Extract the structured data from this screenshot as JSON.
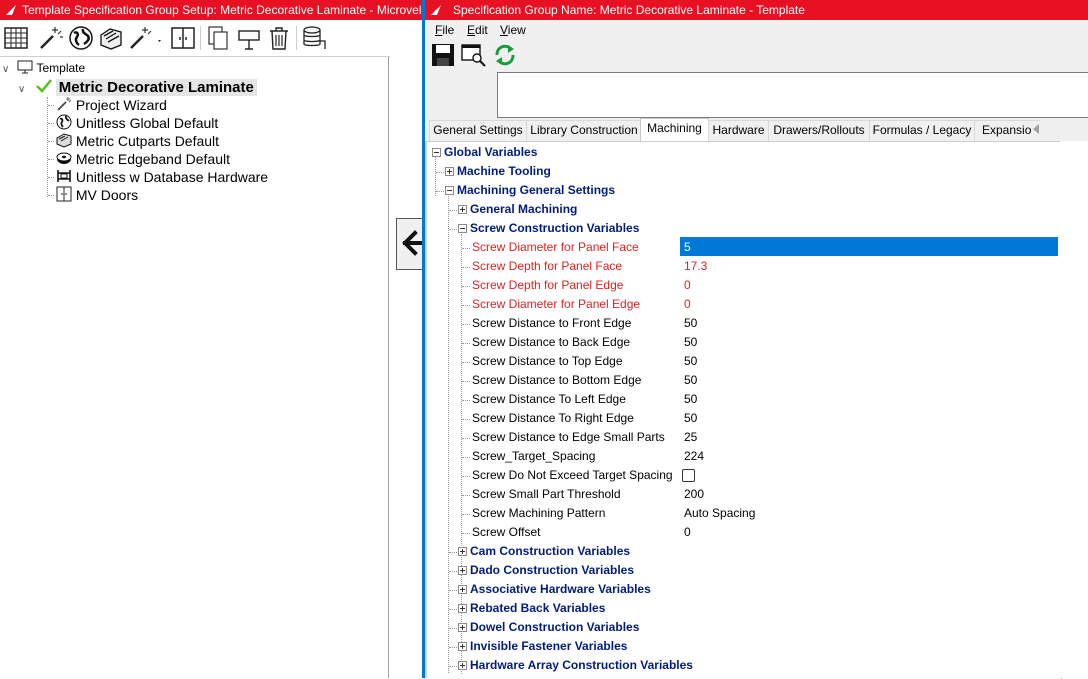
{
  "left_window": {
    "title": "Template Specification Group Setup: Metric Decorative Laminate - Microvellum",
    "toolbar_icons": [
      "grid-icon",
      "wand-icon",
      "globe-icon",
      "cutparts-icon",
      "wand-dropdown-icon",
      "doors-icon",
      "copy-icon",
      "move-icon",
      "trash-icon",
      "database-icon"
    ],
    "tree": {
      "root": "Template",
      "selected": "Metric Decorative Laminate",
      "children": [
        {
          "label": "Project Wizard",
          "icon": "wand-icon"
        },
        {
          "label": "Unitless Global Default",
          "icon": "globe-icon"
        },
        {
          "label": "Metric Cutparts Default",
          "icon": "cutparts-icon"
        },
        {
          "label": "Metric Edgeband Default",
          "icon": "edgeband-icon"
        },
        {
          "label": "Unitless w Database Hardware",
          "icon": "hardware-icon"
        },
        {
          "label": "MV Doors",
          "icon": "doors-icon"
        }
      ]
    }
  },
  "right_window": {
    "title": "Specification Group Name: Metric Decorative Laminate - Template",
    "menu": [
      "File",
      "Edit",
      "View"
    ],
    "toolbar_icons": [
      "save-icon",
      "preview-icon",
      "refresh-icon"
    ],
    "tabs": [
      "General Settings",
      "Library Construction",
      "Machining",
      "Hardware",
      "Drawers/Rollouts",
      "Formulas / Legacy",
      "Expansion"
    ],
    "active_tab": "Machining",
    "tree": {
      "global": "Global Variables",
      "machine_tooling": "Machine Tooling",
      "machining_general": "Machining General Settings",
      "general_machining": "General Machining",
      "screw_group": "Screw Construction Variables",
      "rows": [
        {
          "name": "Screw Diameter for Panel Face",
          "value": "5",
          "red": true
        },
        {
          "name": "Screw Depth for Panel Face",
          "value": "17.3",
          "red": true
        },
        {
          "name": "Screw Depth for Panel Edge",
          "value": "0",
          "red": true
        },
        {
          "name": "Screw Diameter for Panel Edge",
          "value": "0",
          "red": true
        },
        {
          "name": "Screw Distance to Front Edge",
          "value": "50",
          "red": false
        },
        {
          "name": "Screw Distance to Back Edge",
          "value": "50",
          "red": false
        },
        {
          "name": "Screw Distance to Top Edge",
          "value": "50",
          "red": false
        },
        {
          "name": "Screw Distance to Bottom Edge",
          "value": "50",
          "red": false
        },
        {
          "name": "Screw Distance To Left Edge",
          "value": "50",
          "red": false
        },
        {
          "name": "Screw Distance To Right Edge",
          "value": "50",
          "red": false
        },
        {
          "name": "Screw Distance to Edge Small Parts",
          "value": "25",
          "red": false
        },
        {
          "name": "Screw_Target_Spacing",
          "value": "224",
          "red": false
        },
        {
          "name": "Screw Do Not Exceed Target Spacing",
          "value": "",
          "red": false
        },
        {
          "name": "Screw Small Part Threshold",
          "value": "200",
          "red": false
        },
        {
          "name": "Screw Machining Pattern",
          "value": "Auto Spacing",
          "red": false
        },
        {
          "name": "Screw Offset",
          "value": "0",
          "red": false
        }
      ],
      "more_groups": [
        "Cam Construction Variables",
        "Dado Construction Variables",
        "Associative Hardware Variables",
        "Rebated Back Variables",
        "Dowel Construction Variables",
        "Invisible Fastener Variables",
        "Hardware Array Construction Variables"
      ]
    }
  },
  "colors": {
    "title_bar": "#e81123",
    "group_text": "#001c7a",
    "modified_text": "#e02020",
    "selection": "#0078d7"
  }
}
